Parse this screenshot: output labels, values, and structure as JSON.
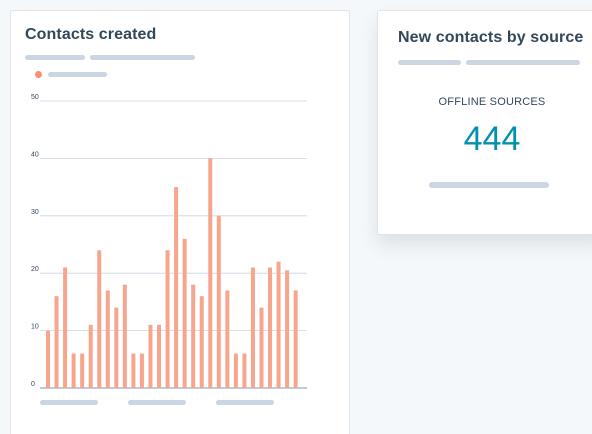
{
  "colors": {
    "page_background": "#f5f8fa",
    "card_background": "#ffffff",
    "bar": "#f8a58d",
    "legend_dot": "#ff8f73",
    "kpi_value": "#0091ae",
    "skeleton": "#cbd6e2",
    "gridline": "#cbd6e2"
  },
  "contacts_card": {
    "title": "Contacts created"
  },
  "source_card": {
    "title": "New contacts by source",
    "kpi_label": "OFFLINE SOURCES",
    "kpi_value": "444"
  },
  "chart_data": {
    "type": "bar",
    "title": "Contacts created",
    "xlabel": "",
    "ylabel": "",
    "ylim": [
      0,
      50
    ],
    "y_ticks": [
      0,
      10,
      20,
      30,
      40,
      50
    ],
    "grid": true,
    "legend": "top-left",
    "values": [
      10,
      16,
      21,
      6,
      6,
      11,
      24,
      17,
      14,
      18,
      6,
      6,
      11,
      11,
      24,
      35,
      26,
      18,
      16,
      40,
      30,
      17,
      6,
      6,
      21,
      14,
      21,
      22,
      20.5,
      17
    ]
  }
}
